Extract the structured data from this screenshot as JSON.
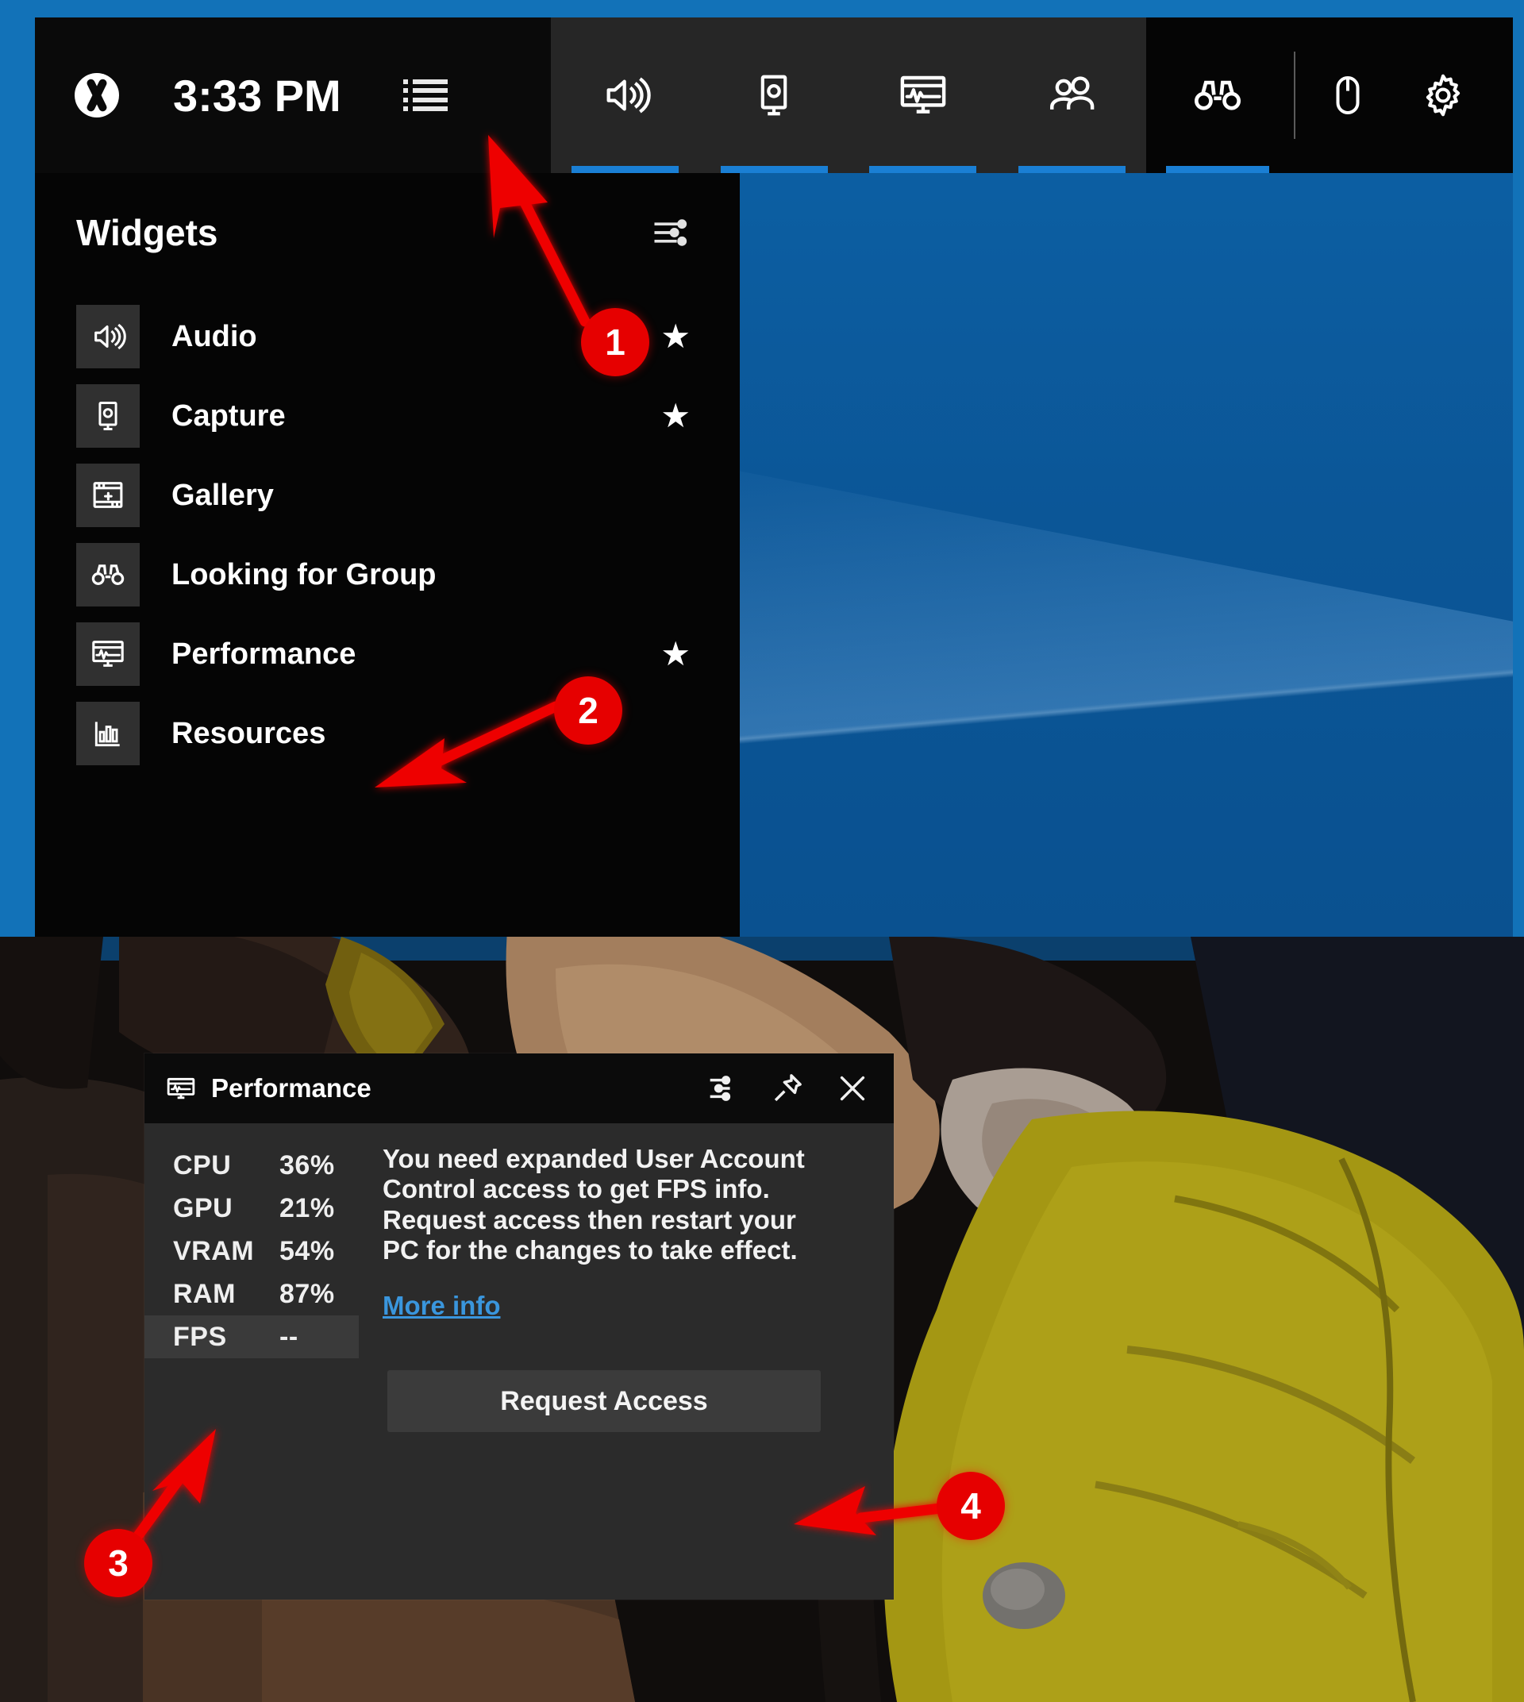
{
  "gamebar": {
    "clock": "3:33 PM",
    "xbox_logo_name": "xbox-logo",
    "widgets_menu_label": "Widgets menu",
    "tabs": [
      {
        "id": "audio",
        "icon": "speaker-icon",
        "active": true
      },
      {
        "id": "capture",
        "icon": "capture-monitor-icon",
        "active": true
      },
      {
        "id": "performance",
        "icon": "performance-monitor-icon",
        "active": true
      },
      {
        "id": "social",
        "icon": "people-icon",
        "active": true
      },
      {
        "id": "lfg",
        "icon": "binoculars-icon",
        "active": true
      }
    ],
    "right_icons": [
      {
        "id": "mouse",
        "icon": "mouse-icon"
      },
      {
        "id": "settings",
        "icon": "gear-icon"
      }
    ]
  },
  "widgets_panel": {
    "title": "Widgets",
    "settings_icon": "sliders-icon",
    "items": [
      {
        "label": "Audio",
        "icon": "speaker-icon",
        "pinned": true
      },
      {
        "label": "Capture",
        "icon": "capture-monitor-icon",
        "pinned": true
      },
      {
        "label": "Gallery",
        "icon": "gallery-icon",
        "pinned": false
      },
      {
        "label": "Looking for Group",
        "icon": "binoculars-icon",
        "pinned": false
      },
      {
        "label": "Performance",
        "icon": "performance-monitor-icon",
        "pinned": true
      },
      {
        "label": "Resources",
        "icon": "bar-chart-icon",
        "pinned": false
      }
    ],
    "star_glyph": "★"
  },
  "performance_widget": {
    "title": "Performance",
    "title_icon": "performance-monitor-icon",
    "actions": [
      {
        "id": "settings",
        "icon": "sliders-icon"
      },
      {
        "id": "pin",
        "icon": "pin-icon"
      },
      {
        "id": "close",
        "icon": "close-icon"
      }
    ],
    "stats": [
      {
        "name": "CPU",
        "value": "36%",
        "highlight": false
      },
      {
        "name": "GPU",
        "value": "21%",
        "highlight": false
      },
      {
        "name": "VRAM",
        "value": "54%",
        "highlight": false
      },
      {
        "name": "RAM",
        "value": "87%",
        "highlight": false
      },
      {
        "name": "FPS",
        "value": "--",
        "highlight": true
      }
    ],
    "message": "You need expanded User Account Control access to get FPS info. Request access then restart your PC for the changes to take effect.",
    "more_info_label": "More info",
    "request_access_label": "Request Access"
  },
  "callouts": [
    {
      "number": "1",
      "target": "widgets-menu-button"
    },
    {
      "number": "2",
      "target": "widget-item-performance"
    },
    {
      "number": "3",
      "target": "fps-stat-row"
    },
    {
      "number": "4",
      "target": "request-access-button"
    }
  ],
  "colors": {
    "accent_blue": "#1a7fd4",
    "callout_red": "#e60000",
    "link_blue": "#3a96dd",
    "wallpaper_blue": "#0b5697",
    "panel_black": "#050505",
    "widget_gray": "#2b2b2b"
  }
}
